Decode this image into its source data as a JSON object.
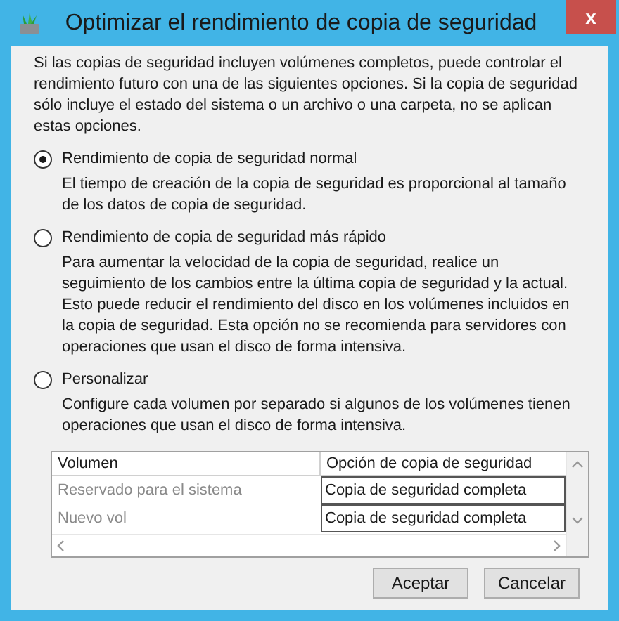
{
  "window": {
    "title": "Optimizar el rendimiento de copia de seguridad",
    "close": "x"
  },
  "intro": "Si las copias de seguridad incluyen volúmenes completos, puede controlar el rendimiento futuro con una de las siguientes opciones. Si la copia de seguridad sólo incluye el estado del sistema o un archivo o una carpeta, no se aplican estas opciones.",
  "options": [
    {
      "label": "Rendimiento de copia de seguridad normal",
      "description": "El tiempo de creación de la copia de seguridad es proporcional al tamaño de los datos de copia de seguridad.",
      "selected": true
    },
    {
      "label": "Rendimiento de copia de seguridad más rápido",
      "description": "Para aumentar la velocidad de la copia de seguridad, realice un seguimiento de los cambios entre la última copia de seguridad y la actual. Esto puede reducir el rendimiento del disco en los volúmenes incluidos en la copia de seguridad. Esta opción no se recomienda para servidores con operaciones que usan el disco de forma intensiva.",
      "selected": false
    },
    {
      "label": "Personalizar",
      "description": "Configure cada volumen por separado si algunos de los volúmenes tienen operaciones que usan el disco de forma intensiva.",
      "selected": false
    }
  ],
  "table": {
    "columns": [
      "Volumen",
      "Opción de copia de seguridad"
    ],
    "rows": [
      {
        "volume": "Reservado para el sistema",
        "option": "Copia de seguridad completa",
        "disabled": true
      },
      {
        "volume": "Nuevo vol",
        "option": "Copia de seguridad completa",
        "disabled": true
      }
    ]
  },
  "buttons": [
    "Aceptar",
    "Cancelar"
  ]
}
